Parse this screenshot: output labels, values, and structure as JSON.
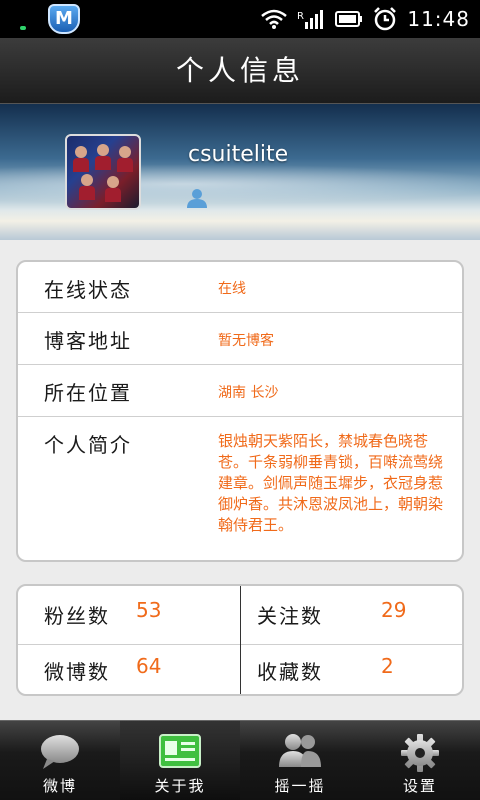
{
  "status_bar": {
    "app_icon_letter": "M",
    "time": "11:48"
  },
  "title_bar": {
    "title": "个人信息"
  },
  "profile": {
    "username": "csuitelite"
  },
  "info": {
    "rows": [
      {
        "label": "在线状态",
        "value": "在线"
      },
      {
        "label": "博客地址",
        "value": "暂无博客"
      },
      {
        "label": "所在位置",
        "value": "湖南 长沙"
      },
      {
        "label": "个人简介",
        "value": "银烛朝天紫陌长，禁城春色晓苍苍。千条弱柳垂青锁，百啭流莺绕建章。剑佩声随玉墀步，衣冠身惹御炉香。共沐恩波凤池上，朝朝染翰侍君王。"
      }
    ]
  },
  "stats": {
    "fans_label": "粉丝数",
    "fans_value": "53",
    "follow_label": "关注数",
    "follow_value": "29",
    "weibo_label": "微博数",
    "weibo_value": "64",
    "fav_label": "收藏数",
    "fav_value": "2"
  },
  "tabs": [
    {
      "label": "微博",
      "icon": "speech-bubble-icon"
    },
    {
      "label": "关于我",
      "icon": "id-card-icon",
      "active": true
    },
    {
      "label": "摇一摇",
      "icon": "people-icon"
    },
    {
      "label": "设置",
      "icon": "gear-icon"
    }
  ],
  "colors": {
    "accent": "#f06a1a",
    "active_tab_icon": "#3fbf3f"
  }
}
